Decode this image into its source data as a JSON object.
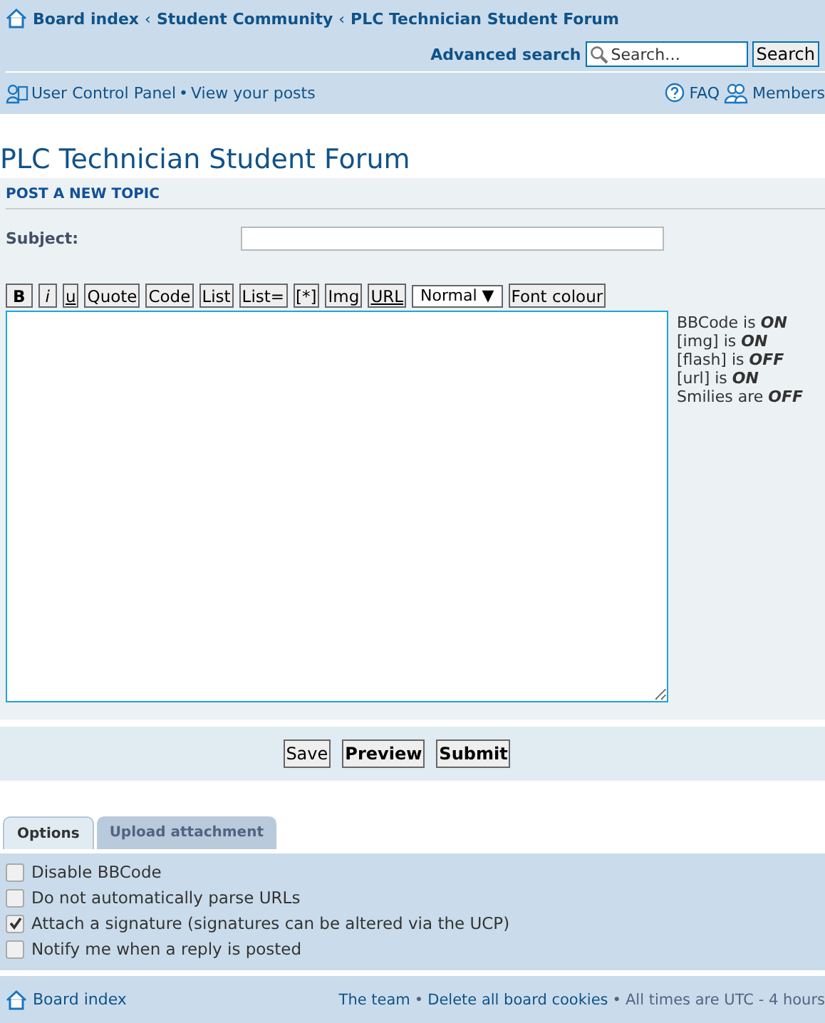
{
  "breadcrumbs": {
    "separator": "‹",
    "items": [
      "Board index",
      "Student Community",
      "PLC Technician Student Forum"
    ]
  },
  "search": {
    "advanced": "Advanced search",
    "placeholder": "Search…",
    "button": "Search"
  },
  "nav": {
    "separator": "•",
    "left": [
      "User Control Panel",
      "View your posts"
    ],
    "right": [
      "FAQ",
      "Members"
    ]
  },
  "forum_title": "PLC Technician Student Forum",
  "post": {
    "heading": "POST A NEW TOPIC",
    "subject_label": "Subject:",
    "toolbar": [
      {
        "kind": "bold",
        "label": "B"
      },
      {
        "kind": "italic",
        "label": "i"
      },
      {
        "kind": "underline",
        "label": "u"
      },
      {
        "kind": "plain",
        "label": "Quote"
      },
      {
        "kind": "plain",
        "label": "Code"
      },
      {
        "kind": "plain",
        "label": "List"
      },
      {
        "kind": "plain",
        "label": "List="
      },
      {
        "kind": "plain",
        "label": "[*]"
      },
      {
        "kind": "plain",
        "label": "Img"
      },
      {
        "kind": "underline",
        "label": "URL"
      },
      {
        "kind": "select",
        "label": "Normal ▼"
      },
      {
        "kind": "plain",
        "label": "Font colour"
      }
    ],
    "status": [
      {
        "text": "BBCode is",
        "value": "ON"
      },
      {
        "text": "[img] is",
        "value": "ON"
      },
      {
        "text": "[flash] is",
        "value": "OFF"
      },
      {
        "text": "[url] is",
        "value": "ON"
      },
      {
        "text": "Smilies are",
        "value": "OFF"
      }
    ]
  },
  "actions": [
    {
      "label": "Save",
      "bold": false
    },
    {
      "label": "Preview",
      "bold": true
    },
    {
      "label": "Submit",
      "bold": true
    }
  ],
  "tabs": [
    {
      "label": "Options",
      "selected": true
    },
    {
      "label": "Upload attachment",
      "selected": false
    }
  ],
  "options": [
    {
      "label": "Disable BBCode",
      "checked": false
    },
    {
      "label": "Do not automatically parse URLs",
      "checked": false
    },
    {
      "label": "Attach a signature (signatures can be altered via the UCP)",
      "checked": true
    },
    {
      "label": "Notify me when a reply is posted",
      "checked": false
    }
  ],
  "footer": {
    "home": "Board index",
    "links": [
      "The team",
      "Delete all board cookies"
    ],
    "separator": "•",
    "timezone": "All times are UTC - 4 hours"
  }
}
